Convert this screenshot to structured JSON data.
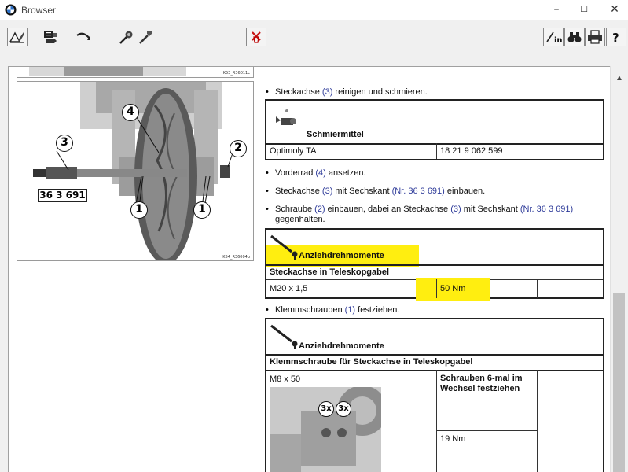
{
  "window": {
    "title": "Browser",
    "minimize": "–",
    "maximize": "☐",
    "close": "✕"
  },
  "toolbar": {
    "icons": [
      "book-edit-icon",
      "document-hand-icon",
      "arrow-return-icon",
      "tools-icon",
      "wrench-icon",
      "no-tool-icon",
      "login-icon",
      "binoculars-icon",
      "print-icon",
      "help-icon"
    ]
  },
  "figure": {
    "top_code": "K53_R36011c",
    "bottom_code": "K54_R36004b",
    "part_number": "36 3 691",
    "callouts": [
      "4",
      "3",
      "2",
      "1",
      "1"
    ]
  },
  "steps": {
    "step1": {
      "pre": "Steckachse ",
      "link": "(3)",
      "post": " reinigen und schmieren."
    },
    "lubricant": {
      "heading": "Schmiermittel",
      "name": "Optimoly TA",
      "number": "18 21 9 062 599"
    },
    "step2": {
      "pre": "Vorderrad ",
      "link": "(4)",
      "post": " ansetzen."
    },
    "step3": {
      "pre": "Steckachse ",
      "link1": "(3)",
      "mid": " mit Sechskant ",
      "link2": "(Nr. 36 3 691)",
      "post": " einbauen."
    },
    "step4": {
      "pre": "Schraube ",
      "link1": "(2)",
      "mid1": " einbauen, dabei an Steckachse ",
      "link2": "(3)",
      "mid2": " mit Sechskant ",
      "link3": "(Nr. 36 3 691)",
      "line2": "gegenhalten."
    },
    "torque1": {
      "heading": "Anziehdrehmomente",
      "row_title": "Steckachse in Teleskopgabel",
      "spec": "M20 x 1,5",
      "value": "50 Nm"
    },
    "step5": {
      "pre": "Klemmschrauben ",
      "link": "(1)",
      "post": " festziehen."
    },
    "torque2": {
      "heading": "Anziehdrehmomente",
      "row_title": "Klemmschraube für Steckachse in Teleskopgabel",
      "spec": "M8 x 50",
      "note": "Schrauben 6-mal im Wechsel festziehen",
      "value": "19 Nm",
      "img_labels": [
        "3x",
        "3x"
      ]
    }
  },
  "colors": {
    "highlight": "#ffee10",
    "link": "#2d3a99"
  }
}
